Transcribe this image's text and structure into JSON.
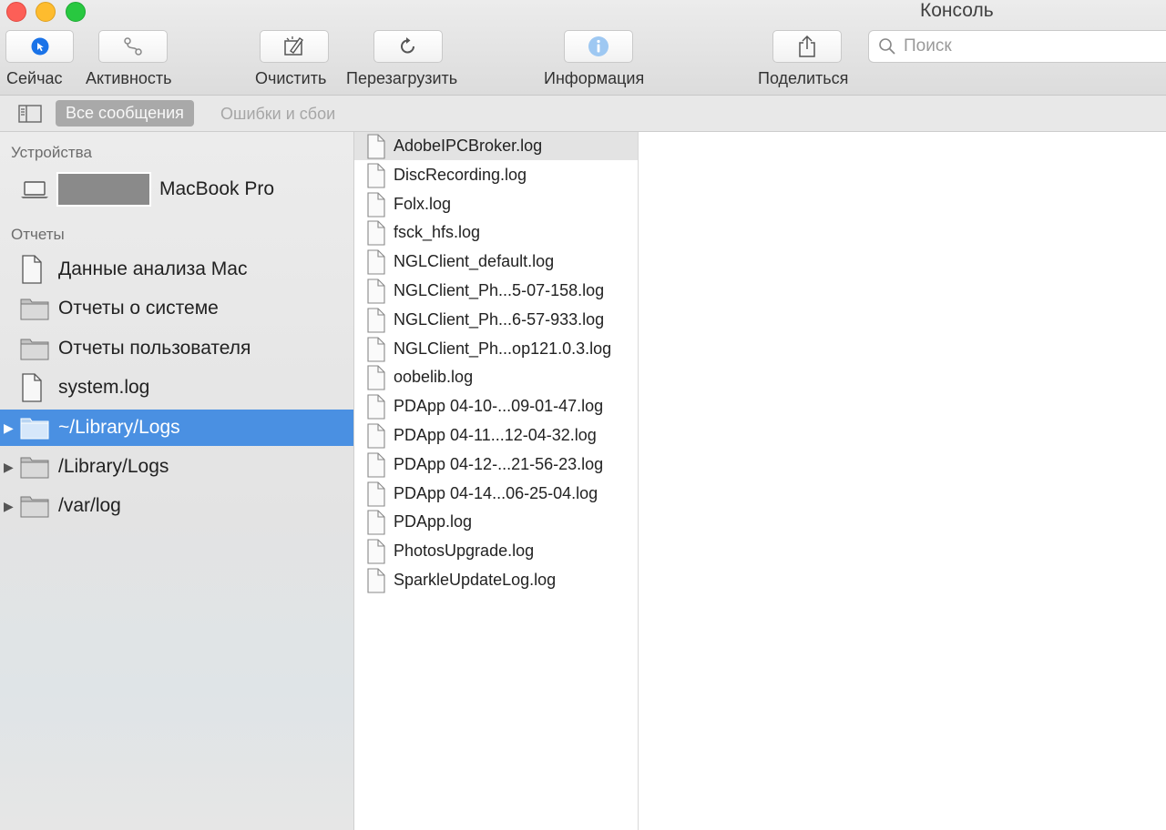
{
  "window": {
    "title": "Консоль"
  },
  "toolbar": {
    "now_label": "Сейчас",
    "activity_label": "Активность",
    "clear_label": "Очистить",
    "reload_label": "Перезагрузить",
    "info_label": "Информация",
    "share_label": "Поделиться",
    "search_placeholder": "Поиск",
    "accent_color": "#1a73e8",
    "info_icon_color": "#9ec8f2"
  },
  "filter": {
    "all_messages": "Все сообщения",
    "errors_faults": "Ошибки и сбои"
  },
  "sidebar": {
    "devices_header": "Устройства",
    "device_name": "MacBook Pro",
    "reports_header": "Отчеты",
    "items": [
      {
        "label": "Данные анализа Mac",
        "icon": "document-icon"
      },
      {
        "label": "Отчеты о системе",
        "icon": "folder-icon"
      },
      {
        "label": "Отчеты пользователя",
        "icon": "folder-icon"
      },
      {
        "label": "system.log",
        "icon": "document-icon"
      },
      {
        "label": "~/Library/Logs",
        "icon": "folder-icon",
        "selected": true,
        "expandable": true
      },
      {
        "label": "/Library/Logs",
        "icon": "folder-icon",
        "expandable": true
      },
      {
        "label": "/var/log",
        "icon": "folder-icon",
        "expandable": true
      }
    ],
    "selection_color": "#4a90e2"
  },
  "files": [
    "AdobeIPCBroker.log",
    "DiscRecording.log",
    "Folx.log",
    "fsck_hfs.log",
    "NGLClient_default.log",
    "NGLClient_Ph...5-07-158.log",
    "NGLClient_Ph...6-57-933.log",
    "NGLClient_Ph...op121.0.3.log",
    "oobelib.log",
    "PDApp 04-10-...09-01-47.log",
    "PDApp 04-11...12-04-32.log",
    "PDApp 04-12-...21-56-23.log",
    "PDApp 04-14...06-25-04.log",
    "PDApp.log",
    "PhotosUpgrade.log",
    "SparkleUpdateLog.log"
  ]
}
